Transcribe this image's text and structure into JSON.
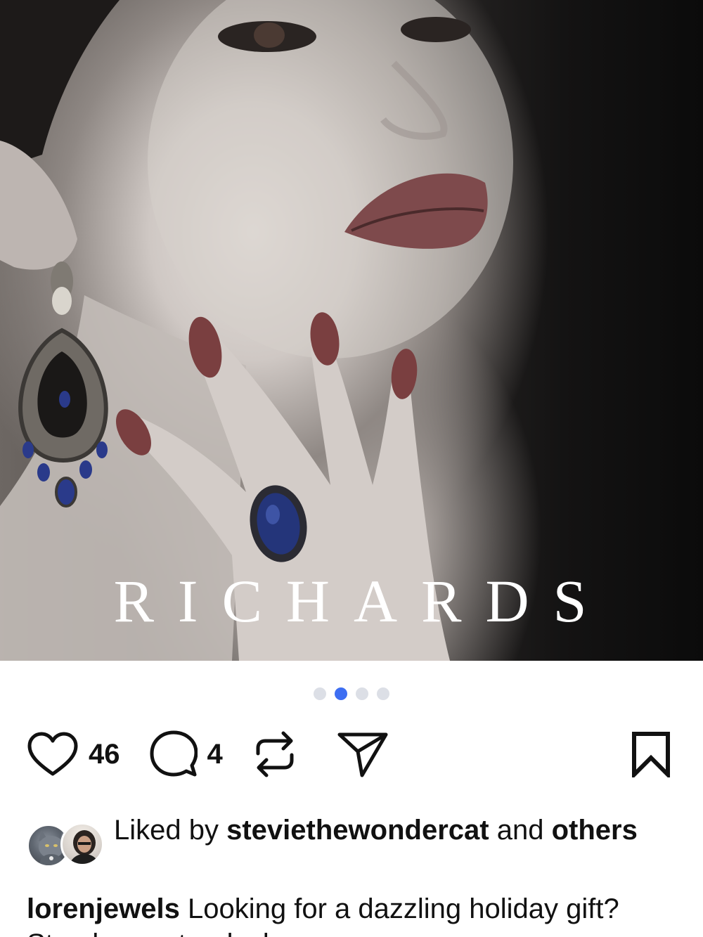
{
  "post": {
    "image_text": "RICHARDS",
    "carousel": {
      "total": 4,
      "active_index": 1
    }
  },
  "actions": {
    "like_count": "46",
    "comment_count": "4",
    "icons": [
      "heart-icon",
      "comment-icon",
      "repost-icon",
      "share-icon",
      "bookmark-icon"
    ]
  },
  "liked_by": {
    "prefix": "Liked by",
    "username": "steviethewondercat",
    "middle": "and",
    "suffix": "others"
  },
  "caption": {
    "username": "lorenjewels",
    "text": "Looking for a dazzling holiday gift? Stop by our trunk show"
  },
  "colors": {
    "accent_dot": "#3d6ef2",
    "inactive_dot": "#dcdfe6",
    "text": "#111111"
  }
}
